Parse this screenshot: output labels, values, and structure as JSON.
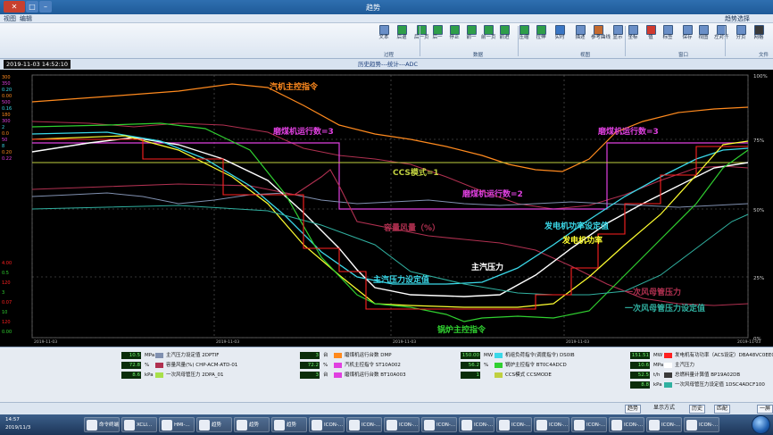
{
  "window": {
    "title": "趋势",
    "corner_label": "趋势选择"
  },
  "menu": {
    "items": [
      "编辑",
      "视图"
    ]
  },
  "ribbon": {
    "buttons": [
      {
        "label": "文本",
        "color": "#6a8fc7"
      },
      {
        "label": "后退",
        "color": "#2f9e4a"
      },
      {
        "label": "后一页",
        "color": "#2f9e4a"
      },
      {
        "label": "后一",
        "color": "#2f9e4a"
      },
      {
        "label": "停止",
        "color": "#2f9e4a"
      },
      {
        "label": "前一",
        "color": "#2f9e4a"
      },
      {
        "label": "前一页",
        "color": "#2f9e4a"
      },
      {
        "label": "前进",
        "color": "#2f9e4a"
      },
      {
        "label": "压缩",
        "color": "#2f9e4a"
      },
      {
        "label": "拉伸",
        "color": "#2f9e4a"
      },
      {
        "label": "实时",
        "color": "#3a76c4"
      },
      {
        "label": "描述",
        "color": "#6a8fc7"
      },
      {
        "label": "参考曲线",
        "color": "#c46a2f"
      },
      {
        "label": "显示",
        "color": "#6a8fc7"
      },
      {
        "label": "坐标",
        "color": "#6a8fc7"
      },
      {
        "label": "值",
        "color": "#d03a2f"
      },
      {
        "label": "标签",
        "color": "#6a8fc7"
      },
      {
        "label": "保存",
        "color": "#6a8fc7"
      },
      {
        "label": "视图",
        "color": "#6a8fc7"
      },
      {
        "label": "左对齐",
        "color": "#6a8fc7"
      },
      {
        "label": "分页",
        "color": "#6a8fc7"
      },
      {
        "label": "网格",
        "color": "#3a3a3a"
      },
      {
        "label": "保存",
        "color": "#3a76c4"
      },
      {
        "label": "另存",
        "color": "#3a76c4"
      },
      {
        "label": "打开",
        "color": "#d9a63a"
      }
    ],
    "groups": [
      "文件",
      "窗口",
      "视图",
      "数据",
      "过程"
    ]
  },
  "chart_header": {
    "time": "2019-11-03 14:52:10",
    "title": "历史趋势---统计---ADC"
  },
  "right_axis": [
    "100%",
    "75%",
    "50%",
    "25%",
    "0%"
  ],
  "left_scale_top": [
    "300",
    "350",
    "0.20",
    "0.00",
    "500",
    "0.16",
    "180",
    "300",
    "2",
    "0.0",
    "50",
    "8",
    "0.20",
    "0.22"
  ],
  "left_scale_bottom": [
    "4.00",
    "0.5",
    "120",
    "3",
    "0.07",
    "10",
    "120",
    "0.00"
  ],
  "time_axis": [
    {
      "date": "2019-11-03",
      "time": "12:52:10"
    },
    {
      "date": "2019-11-03",
      "time": "13:29:10"
    },
    {
      "date": "2019-11-03",
      "time": "14:09:10"
    },
    {
      "date": "2019-11-03",
      "time": "14:49:10"
    },
    {
      "date": "2019-11-03",
      "time": "15:29:10"
    }
  ],
  "annotations": {
    "steam_turbine_cmd": "汽机主控指令",
    "mill_run_count_3a": "磨煤机运行数=3",
    "mill_run_count_3b": "磨煤机运行数=3",
    "ccs_mode": "CCS模式=1",
    "mill_run_count_2": "磨煤机运行数=2",
    "capacity_air": "容量风量（%）",
    "gen_power_setpoint": "发电机功率设定值",
    "gen_power": "发电机功率",
    "main_steam_pressure": "主汽压力",
    "main_steam_pressure_sp": "主汽压力设定值",
    "primary_air_pressure": "一次风母管压力",
    "primary_air_pressure_sp": "一次风母管压力设定值",
    "boiler_master_cmd": "锅炉主控指令"
  },
  "colors": {
    "orange": "#ff8a1e",
    "magenta": "#e040e0",
    "white": "#ffffff",
    "cyan": "#3ad8e8",
    "yellow": "#ffff30",
    "green": "#30d030",
    "olive": "#c0d040",
    "red": "#ff2020",
    "maroon": "#b03050",
    "slate": "#8090b0",
    "teal": "#30b0a0",
    "greenline": "#a8e04a"
  },
  "legend": {
    "col1": [
      {
        "name": "发电机有功功率（ACS设定）DBA48VC0EE0QRT03",
        "value": "151.51",
        "unit": "MW",
        "color": "#ff2020"
      },
      {
        "name": "主汽压力",
        "value": "10.6",
        "unit": "MPa",
        "color": "#ffffff"
      },
      {
        "name": "总燃料量计算值 BP19A02DB",
        "value": "52.5",
        "unit": "t/h",
        "color": "#3a3a3a"
      },
      {
        "name": "一次风母管压力设定值 1DSC4ADCF100",
        "value": "8.8",
        "unit": "kPa",
        "color": "#30b0a0"
      }
    ],
    "col2": [
      {
        "name": "机组负荷指令(调度指令) DS0IB",
        "value": "150.00",
        "unit": "MW",
        "color": "#3ad8e8"
      },
      {
        "name": "锅炉主控指令 BT0C4ADCD",
        "value": "56.2",
        "unit": "%",
        "color": "#30d030"
      },
      {
        "name": "CCS模式 CCSMODE",
        "value": "1",
        "unit": "",
        "color": "#c0d040"
      }
    ],
    "col3": [
      {
        "name": "磨煤机运行台数 DMP",
        "value": "3",
        "unit": "台",
        "color": "#ff8a1e"
      },
      {
        "name": "汽机主控指令 ST10A002",
        "value": "72.2",
        "unit": "%",
        "color": "#e040e0"
      },
      {
        "name": "磨煤机运行台数 BT10A003",
        "value": "3",
        "unit": "台",
        "color": "#e040e0"
      }
    ],
    "col4": [
      {
        "name": "主汽压力设定值 2DPTIF",
        "value": "10.5",
        "unit": "MPa",
        "color": "#8090b0"
      },
      {
        "name": "容量风量(%) CHP-ACM-ATD-01",
        "value": "72.8",
        "unit": "%",
        "color": "#b03050"
      },
      {
        "name": "一次风母管压力 2DPA_01",
        "value": "8.6",
        "unit": "kPa",
        "color": "#a8e04a"
      }
    ]
  },
  "status": {
    "btn1": "一屏",
    "btn2": "匹配",
    "btn3": "历史",
    "btn4": "显示方式",
    "btn5": "趋势"
  },
  "taskbar": {
    "items": [
      "ICON-...",
      "ICON-...",
      "ICON-...",
      "ICON-...",
      "ICON-...",
      "ICON-...",
      "ICON-...",
      "ICON-...",
      "ICON-...",
      "ICON-...",
      "ICON-...",
      "趋势",
      "趋势",
      "趋势",
      "HMI-...",
      "XCLI...",
      "命令终端"
    ],
    "clock": {
      "time": "14:57",
      "date": "2019/11/3"
    }
  }
}
